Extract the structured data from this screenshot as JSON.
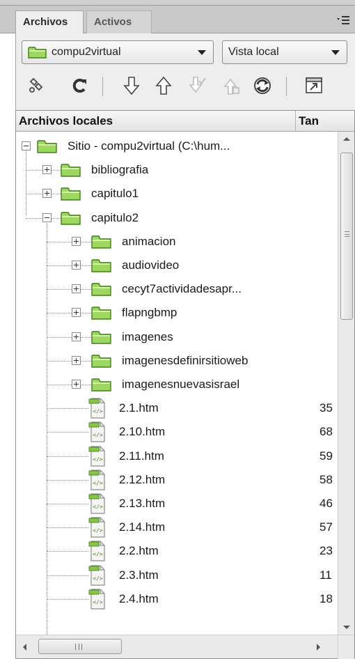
{
  "panel": {
    "tabs": [
      {
        "label": "Archivos",
        "active": true
      },
      {
        "label": "Activos",
        "active": false
      }
    ],
    "menu_icon": "panel-options-icon"
  },
  "toolbar": {
    "site_select": {
      "value": "compu2virtual",
      "icon": "folder-icon"
    },
    "view_select": {
      "value": "Vista local"
    },
    "icons": [
      "connect-icon",
      "refresh-icon",
      "get-files-icon",
      "put-files-icon",
      "check-out-icon",
      "check-in-icon",
      "synchronize-icon",
      "expand-panel-icon"
    ]
  },
  "file_list": {
    "headers": {
      "name": "Archivos locales",
      "size": "Tan"
    },
    "rows": [
      {
        "label": "Sitio - compu2virtual (C:\\hum...",
        "type": "site",
        "level": 0,
        "expander": "minus",
        "size": ""
      },
      {
        "label": "bibliografia",
        "type": "folder",
        "level": 1,
        "expander": "plus",
        "size": ""
      },
      {
        "label": "capitulo1",
        "type": "folder",
        "level": 1,
        "expander": "plus",
        "size": ""
      },
      {
        "label": "capitulo2",
        "type": "folder",
        "level": 1,
        "expander": "minus",
        "size": ""
      },
      {
        "label": "animacion",
        "type": "folder",
        "level": 2,
        "expander": "plus",
        "size": ""
      },
      {
        "label": "audiovideo",
        "type": "folder",
        "level": 2,
        "expander": "plus",
        "size": ""
      },
      {
        "label": "cecyt7actividadesapr...",
        "type": "folder",
        "level": 2,
        "expander": "plus",
        "size": ""
      },
      {
        "label": "flapngbmp",
        "type": "folder",
        "level": 2,
        "expander": "plus",
        "size": ""
      },
      {
        "label": "imagenes",
        "type": "folder",
        "level": 2,
        "expander": "plus",
        "size": ""
      },
      {
        "label": "imagenesdefinirsitioweb",
        "type": "folder",
        "level": 2,
        "expander": "plus",
        "size": ""
      },
      {
        "label": "imagenesnuevasisrael",
        "type": "folder",
        "level": 2,
        "expander": "plus",
        "size": ""
      },
      {
        "label": "2.1.htm",
        "type": "file",
        "level": 2,
        "size": "35"
      },
      {
        "label": "2.10.htm",
        "type": "file",
        "level": 2,
        "size": "68"
      },
      {
        "label": "2.11.htm",
        "type": "file",
        "level": 2,
        "size": "59"
      },
      {
        "label": "2.12.htm",
        "type": "file",
        "level": 2,
        "size": "58"
      },
      {
        "label": "2.13.htm",
        "type": "file",
        "level": 2,
        "size": "46"
      },
      {
        "label": "2.14.htm",
        "type": "file",
        "level": 2,
        "size": "57"
      },
      {
        "label": "2.2.htm",
        "type": "file",
        "level": 2,
        "size": "23"
      },
      {
        "label": "2.3.htm",
        "type": "file",
        "level": 2,
        "size": "11"
      },
      {
        "label": "2.4.htm",
        "type": "file",
        "level": 2,
        "size": "18"
      }
    ]
  },
  "colors": {
    "panel_bg": "#eeeeee",
    "tab_strip": "#c9c9c9",
    "folder_fill": "#b6e37a",
    "folder_stroke": "#4c8f1d"
  }
}
